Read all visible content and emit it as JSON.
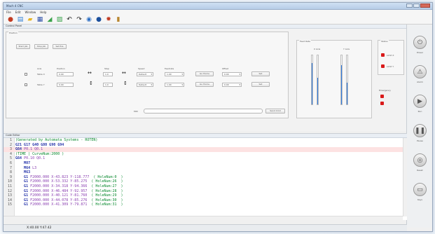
{
  "window": {
    "title": "Mach 4 CNC"
  },
  "menu": [
    "File",
    "Edit",
    "Window",
    "Help"
  ],
  "toolbar": [
    {
      "icon": "stop-icon",
      "glyph": "●",
      "color": "#c23b22"
    },
    {
      "icon": "open-icon",
      "glyph": "▤",
      "color": "#2d7fd4"
    },
    {
      "icon": "folder-icon",
      "glyph": "▰",
      "color": "#e6b422"
    },
    {
      "icon": "save-icon",
      "glyph": "▦",
      "color": "#2d4fa8"
    },
    {
      "icon": "graph-icon",
      "glyph": "◢",
      "color": "#3aa34b"
    },
    {
      "icon": "image-icon",
      "glyph": "▨",
      "color": "#3aa34b"
    },
    {
      "icon": "undo-icon",
      "glyph": "↶",
      "color": "#222222"
    },
    {
      "icon": "redo-icon",
      "glyph": "↷",
      "color": "#222222"
    },
    {
      "icon": "globe-icon",
      "glyph": "◉",
      "color": "#2d6fc4"
    },
    {
      "icon": "info-icon",
      "glyph": "●",
      "color": "#1b4f9c"
    },
    {
      "icon": "settings-icon",
      "glyph": "✹",
      "color": "#c23b22"
    },
    {
      "icon": "book-icon",
      "glyph": "▮",
      "color": "#b8862e"
    }
  ],
  "control_panel": {
    "title": "Control Panel",
    "group_label": "Position",
    "top_buttons": [
      "Start Job",
      "Stop Job",
      "Set Pos"
    ],
    "headers": [
      "Axis",
      "Position",
      "Jog",
      "Step",
      "Speed",
      "Feedrate",
      "",
      "Offset",
      ""
    ],
    "rows": [
      {
        "axis": "Table X",
        "position": "0.00",
        "jog": "↔",
        "step": "1.0",
        "speed": "Default",
        "feed": "1.00",
        "btn1": "Go Home",
        "offset": "0.00",
        "btn2": "Set"
      },
      {
        "axis": "Table Y",
        "position": "0.00",
        "jog": "↕",
        "step": "1.0",
        "speed": "Default",
        "feed": "1.00",
        "btn1": "Go Home",
        "offset": "0.00",
        "btn2": "Set"
      }
    ],
    "input_label": "MDI",
    "input_button": "Send Cmd",
    "gauges_label": "Feed Rate",
    "gauge_captions": [
      "X Axis",
      "Y Axis"
    ],
    "gauge_levels": [
      0.85,
      0.55,
      0.8,
      0.45
    ],
    "status_label": "Status",
    "status_items": [
      "Limit X",
      "Limit Y"
    ],
    "estop_label": "Emergency"
  },
  "sidebar": [
    {
      "icon": "power-icon",
      "glyph": "⏻",
      "label": "Power"
    },
    {
      "icon": "warning-icon",
      "glyph": "⚠",
      "label": "Alarm"
    },
    {
      "icon": "play-icon",
      "glyph": "▶",
      "label": "Run"
    },
    {
      "icon": "pause-icon",
      "glyph": "❚❚",
      "label": "Pause"
    },
    {
      "icon": "reset-icon",
      "glyph": "◎",
      "label": "Reset"
    },
    {
      "icon": "keyboard-icon",
      "glyph": "▭",
      "label": "Keys"
    }
  ],
  "editor": {
    "title": "Code Editor",
    "lines": [
      {
        "n": "1",
        "parts": [
          {
            "t": "(Generated by Automata Systems - ROTEN)",
            "c": "cm"
          }
        ]
      },
      {
        "n": "2",
        "parts": [
          {
            "t": "G21 G17 G40 G80 G90 G94",
            "c": "kw"
          }
        ]
      },
      {
        "n": "3",
        "hl": true,
        "parts": [
          {
            "t": "G64 ",
            "c": "kw"
          },
          {
            "t": "P0.1 Q0.1",
            "c": "nm"
          }
        ]
      },
      {
        "n": "4",
        "parts": [
          {
            "t": "(TIME | CurveNum:2000 )",
            "c": "cm"
          }
        ]
      },
      {
        "n": "5",
        "parts": [
          {
            "t": "G64 ",
            "c": "kw"
          },
          {
            "t": "P0.10 Q0.1",
            "c": "nm"
          }
        ]
      },
      {
        "n": "6",
        "parts": [
          {
            "t": "    M07",
            "c": "kw"
          }
        ]
      },
      {
        "n": "7",
        "parts": [
          {
            "t": "    M64 ",
            "c": "kw"
          },
          {
            "t": "L3",
            "c": "nm"
          }
        ]
      },
      {
        "n": "8",
        "parts": [
          {
            "t": "    M63",
            "c": "kw"
          }
        ]
      },
      {
        "n": "9",
        "parts": [
          {
            "t": "    G1 ",
            "c": "kw"
          },
          {
            "t": "F2000.000 X-43.823 Y-118.777  ",
            "c": "nm"
          },
          {
            "t": "( HoleNum:0  )",
            "c": "cm"
          }
        ]
      },
      {
        "n": "10",
        "parts": [
          {
            "t": "    G1 ",
            "c": "kw"
          },
          {
            "t": "F2000.000 X-53.332 Y-85.275  ",
            "c": "nm"
          },
          {
            "t": "( HoleNum:26  )",
            "c": "cm"
          }
        ]
      },
      {
        "n": "11",
        "parts": [
          {
            "t": "    G1 ",
            "c": "kw"
          },
          {
            "t": "F2000.000 X-34.318 Y-94.366  ",
            "c": "nm"
          },
          {
            "t": "( HoleNum:27  )",
            "c": "cm"
          }
        ]
      },
      {
        "n": "12",
        "parts": [
          {
            "t": "    G1 ",
            "c": "kw"
          },
          {
            "t": "F2000.000 X-46.484 Y-92.957  ",
            "c": "nm"
          },
          {
            "t": "( HoleNum:28  )",
            "c": "cm"
          }
        ]
      },
      {
        "n": "13",
        "parts": [
          {
            "t": "    G1 ",
            "c": "kw"
          },
          {
            "t": "F2000.000 X-40.121 Y-81.760  ",
            "c": "nm"
          },
          {
            "t": "( HoleNum:29  )",
            "c": "cm"
          }
        ]
      },
      {
        "n": "14",
        "parts": [
          {
            "t": "    G1 ",
            "c": "kw"
          },
          {
            "t": "F2000.000 X-44.078 Y-85.276  ",
            "c": "nm"
          },
          {
            "t": "( HoleNum:30  )",
            "c": "cm"
          }
        ]
      },
      {
        "n": "15",
        "parts": [
          {
            "t": "    G1 ",
            "c": "kw"
          },
          {
            "t": "F2000.000 X-41.309 Y-79.871  ",
            "c": "nm"
          },
          {
            "t": "( HoleNum:31  )",
            "c": "cm"
          }
        ]
      }
    ]
  },
  "status": {
    "coords": "X:40.00  Y:47.42"
  }
}
